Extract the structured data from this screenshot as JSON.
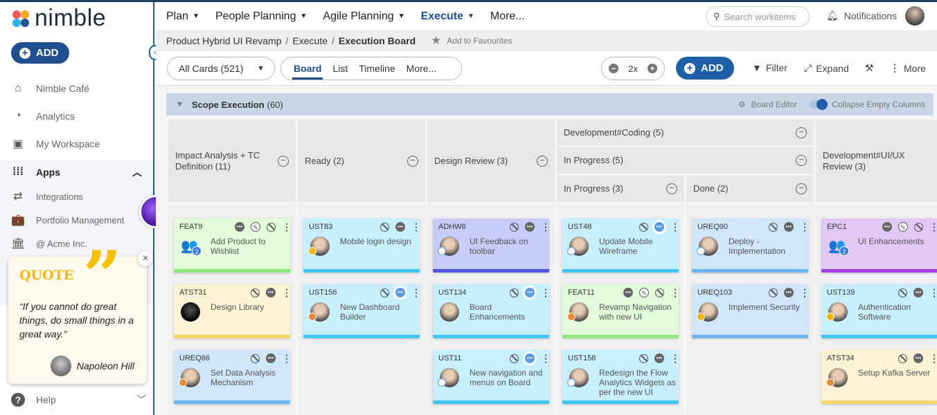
{
  "app": {
    "logo": "nimble",
    "add_label": "ADD"
  },
  "sidebar": {
    "items": [
      {
        "label": "Nimble Café",
        "icon": "home-icon"
      },
      {
        "label": "Analytics",
        "icon": "gauge-icon"
      },
      {
        "label": "My Workspace",
        "icon": "workspace-icon"
      }
    ],
    "apps_label": "Apps",
    "apps_items": [
      {
        "label": "Integrations",
        "icon": "swap-icon"
      },
      {
        "label": "Portfolio Management",
        "icon": "briefcase-icon"
      },
      {
        "label": "@ Acme Inc.",
        "icon": "bank-icon"
      }
    ],
    "help_label": "Help"
  },
  "quote": {
    "title": "QUOTE",
    "text": "“If you cannot do great things, do small things in a great way.”",
    "author": "Napoleon Hill"
  },
  "topnav": {
    "items": [
      {
        "label": "Plan"
      },
      {
        "label": "People Planning"
      },
      {
        "label": "Agile Planning"
      },
      {
        "label": "Execute",
        "active": true
      },
      {
        "label": "More..."
      }
    ],
    "search_placeholder": "Search workitems",
    "notifications": "Notifications"
  },
  "breadcrumb": {
    "items": [
      "Product Hybrid UI Revamp",
      "Execute",
      "Execution Board"
    ],
    "favourite": "Add to Favourites"
  },
  "toolbar": {
    "filter_select": "All Cards (521)",
    "views": [
      "Board",
      "List",
      "Timeline",
      "More..."
    ],
    "active_view": "Board",
    "zoom": "2x",
    "add": "ADD",
    "filter": "Filter",
    "expand": "Expand",
    "more": "More"
  },
  "lane": {
    "title": "Scope Execution",
    "count": "(60)",
    "board_editor": "Board Editor",
    "collapse_empty": "Collapse Empty Columns",
    "collapse_empty_on": true
  },
  "columns": {
    "c1": "Impact Analysis + TC Definition (11)",
    "c2": "Ready (2)",
    "c3": "Design Review (3)",
    "dev": "Development#Coding (5)",
    "inprog": "In Progress (5)",
    "inprog2": "In Progress (3)",
    "done": "Done (2)",
    "c6": "Development#UI/UX Review (3)"
  },
  "colors": {
    "green": [
      "#e2fbd8",
      "#8fe97c"
    ],
    "cyan": [
      "#c8effd",
      "#3ec7f1"
    ],
    "indigo": [
      "#c8ccf8",
      "#4b55db"
    ],
    "yellow": [
      "#fdf2d5",
      "#f8d46c"
    ],
    "blue": [
      "#d0e6fb",
      "#6cb4f2"
    ],
    "violet": [
      "#e2c8f7",
      "#a23ee0"
    ]
  },
  "cards": [
    {
      "col": 0,
      "row": 0,
      "id": "FEAT9",
      "title": "Add Product to Wishlist",
      "color": "green",
      "icons": [
        "comment",
        "edit",
        "block",
        "more"
      ],
      "avatar": "group",
      "count": "2"
    },
    {
      "col": 0,
      "row": 1,
      "id": "ATST31",
      "title": "Design Library",
      "color": "yellow",
      "icons": [
        "block",
        "comment",
        "more"
      ],
      "avatar": "dark"
    },
    {
      "col": 0,
      "row": 2,
      "id": "UREQ86",
      "title": "Set Data Analysis Mechanism",
      "color": "blue",
      "icons": [
        "block",
        "comment",
        "more"
      ],
      "avatar": "person",
      "medal": "bronze"
    },
    {
      "col": 1,
      "row": 0,
      "id": "UST83",
      "title": "Mobile login design",
      "color": "cyan",
      "icons": [
        "block",
        "comment",
        "more"
      ],
      "avatar": "person",
      "medal": "gold"
    },
    {
      "col": 1,
      "row": 1,
      "id": "UST156",
      "title": "New Dashboard Builder",
      "color": "cyan",
      "icons": [
        "block",
        "comment-on",
        "more"
      ],
      "avatar": "person",
      "medal": "bronze"
    },
    {
      "col": 2,
      "row": 0,
      "id": "ADHW6",
      "title": "UI Feedback on toolbar",
      "color": "indigo",
      "icons": [
        "block",
        "comment",
        "more"
      ],
      "avatar": "person",
      "medal": "silver"
    },
    {
      "col": 2,
      "row": 1,
      "id": "UST134",
      "title": "Board Enhancements",
      "color": "cyan",
      "icons": [
        "block",
        "comment-on",
        "more"
      ],
      "avatar": "person"
    },
    {
      "col": 2,
      "row": 2,
      "id": "UST11",
      "title": "New navigation and menus on Board",
      "color": "cyan",
      "icons": [
        "block",
        "comment-on",
        "more"
      ],
      "avatar": "person",
      "medal": "silver"
    },
    {
      "col": 3,
      "row": 0,
      "id": "UST48",
      "title": "Update Mobile Wireframe",
      "color": "cyan",
      "icons": [
        "block",
        "comment-on",
        "more"
      ],
      "avatar": "person",
      "medal": "silver"
    },
    {
      "col": 3,
      "row": 1,
      "id": "FEAT11",
      "title": "Revamp Navigation with new UI",
      "color": "green",
      "icons": [
        "comment",
        "edit",
        "block",
        "more"
      ],
      "avatar": "person",
      "medal": "bronze"
    },
    {
      "col": 3,
      "row": 2,
      "id": "UST158",
      "title": "Redesign the Flow Analytics Widgets as per the new UI",
      "color": "cyan",
      "icons": [
        "block",
        "comment",
        "more"
      ],
      "avatar": "person",
      "medal": "silver"
    },
    {
      "col": 4,
      "row": 0,
      "id": "UREQ90",
      "title": "Deploy - Implementation",
      "color": "blue",
      "icons": [
        "block",
        "comment",
        "more"
      ],
      "avatar": "person",
      "medal": "silver"
    },
    {
      "col": 4,
      "row": 1,
      "id": "UREQ103",
      "title": "Implement Security",
      "color": "blue",
      "icons": [
        "block",
        "comment",
        "more"
      ],
      "avatar": "person",
      "medal": "gold"
    },
    {
      "col": 5,
      "row": 0,
      "id": "EPC1",
      "title": "UI Enhancements",
      "color": "violet",
      "icons": [
        "comment",
        "edit",
        "block",
        "more"
      ],
      "avatar": "group",
      "count": "2"
    },
    {
      "col": 5,
      "row": 1,
      "id": "UST139",
      "title": "Authentication Software",
      "color": "cyan",
      "icons": [
        "block",
        "comment",
        "more"
      ],
      "avatar": "person",
      "medal": "gold"
    },
    {
      "col": 5,
      "row": 2,
      "id": "ATST34",
      "title": "Setup Kafka Server",
      "color": "yellow",
      "icons": [
        "block",
        "comment",
        "more"
      ],
      "avatar": "person",
      "medal": "bronze"
    }
  ]
}
